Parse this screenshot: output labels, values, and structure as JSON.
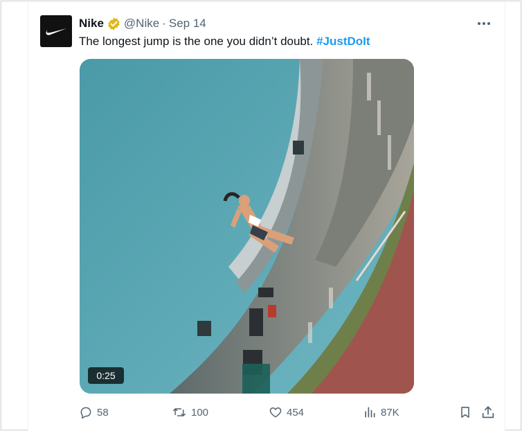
{
  "tweet": {
    "name": "Nike",
    "handle": "@Nike",
    "separator": "·",
    "date": "Sep 14",
    "text": "The longest jump is the one you didn’t doubt.",
    "hashtag": "#JustDoIt"
  },
  "media": {
    "duration": "0:25"
  },
  "actions": {
    "replies": "58",
    "reposts": "100",
    "likes": "454",
    "views": "87K"
  },
  "icons": {
    "avatar": "nike-swoosh-icon",
    "verified": "verified-badge-icon",
    "more": "more-dots-icon",
    "reply": "reply-icon",
    "repost": "repost-icon",
    "like": "heart-icon",
    "views": "views-icon",
    "bookmark": "bookmark-icon",
    "share": "share-icon"
  },
  "colors": {
    "accent": "#1d9bf0",
    "verified": "#e2b719",
    "muted": "#536471",
    "text": "#0f1419"
  }
}
